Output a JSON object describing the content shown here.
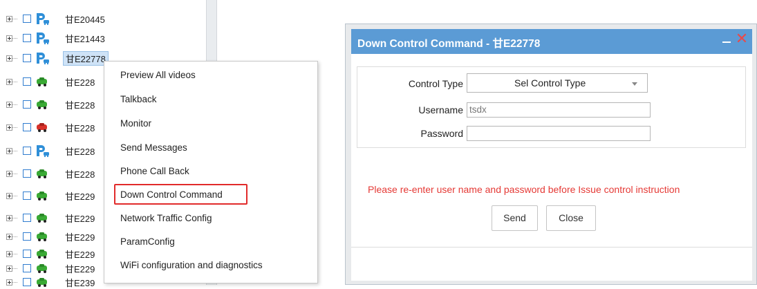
{
  "tree": {
    "rows": [
      {
        "plate": "甘E20445",
        "icon": "parking-car-icon",
        "selected": false
      },
      {
        "plate": "甘E21443",
        "icon": "parking-car-icon",
        "selected": false
      },
      {
        "plate": "甘E22778",
        "icon": "parking-car-icon",
        "selected": true
      },
      {
        "plate": "甘E228",
        "icon": "green-car-icon",
        "selected": false
      },
      {
        "plate": "甘E228",
        "icon": "green-car-icon",
        "selected": false
      },
      {
        "plate": "甘E228",
        "icon": "red-car-icon",
        "selected": false
      },
      {
        "plate": "甘E228",
        "icon": "parking-car-icon",
        "selected": false
      },
      {
        "plate": "甘E228",
        "icon": "green-car-icon",
        "selected": false
      },
      {
        "plate": "甘E229",
        "icon": "green-car-icon",
        "selected": false
      },
      {
        "plate": "甘E229",
        "icon": "green-car-icon",
        "selected": false
      },
      {
        "plate": "甘E229",
        "icon": "green-car-icon",
        "selected": false
      },
      {
        "plate": "甘E229",
        "icon": "green-car-icon",
        "selected": false
      },
      {
        "plate": "甘E229",
        "icon": "green-car-icon",
        "selected": false
      },
      {
        "plate": "甘E239",
        "icon": "green-car-icon",
        "selected": false
      }
    ]
  },
  "context_menu": {
    "items": [
      "Preview All videos",
      "Talkback",
      "Monitor",
      "Send Messages",
      "Phone Call Back",
      "Down Control Command",
      "Network Traffic Config",
      "ParamConfig",
      "WiFi configuration and diagnostics"
    ],
    "highlighted": "Down Control Command",
    "highlight_color": "#e12a2a"
  },
  "dialog": {
    "title": "Down Control Command - 甘E22778",
    "titlebar_color": "#5b9bd5",
    "control_type_label": "Control Type",
    "control_type_value": "Sel Control Type",
    "username_label": "Username",
    "username_value": "tsdx",
    "password_label": "Password",
    "password_value": "",
    "warning": "Please re-enter user name and password before Issue control instruction",
    "warning_color": "#e53935",
    "send_label": "Send",
    "close_label": "Close"
  }
}
